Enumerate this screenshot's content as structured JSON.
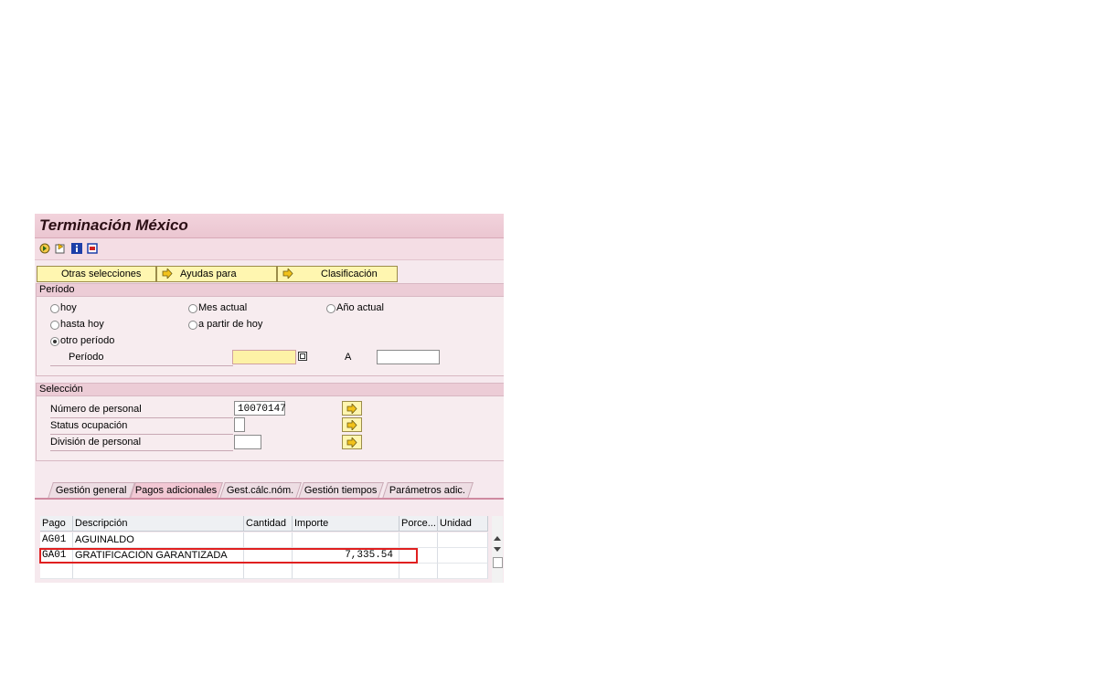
{
  "window": {
    "title": "Terminación México"
  },
  "app_toolbar": {
    "icons": [
      "execute-icon",
      "get-variant-icon",
      "info-icon",
      "selection-options-icon"
    ]
  },
  "buttons": {
    "otras_selecciones": "Otras selecciones",
    "ayudas_busqueda": "Ayudas para búsqueda",
    "clasificacion": "Clasificación"
  },
  "periodo": {
    "title": "Período",
    "options": {
      "hoy": "hoy",
      "mes_actual": "Mes actual",
      "ano_actual": "Año actual",
      "hasta_hoy": "hasta hoy",
      "a_partir": "a partir de hoy",
      "otro": "otro período"
    },
    "selected": "otro período",
    "field_label": "Período",
    "from_value": "",
    "to_label": "A",
    "to_value": ""
  },
  "seleccion": {
    "title": "Selección",
    "numero_label": "Número de personal",
    "numero_value": "10070147",
    "status_label": "Status ocupación",
    "status_value": "",
    "division_label": "División de personal",
    "division_value": ""
  },
  "tabs": [
    {
      "label": "Gestión general",
      "active": false
    },
    {
      "label": "Pagos adicionales",
      "active": true
    },
    {
      "label": "Gest.cálc.nóm.",
      "active": false
    },
    {
      "label": "Gestión tiempos",
      "active": false
    },
    {
      "label": "Parámetros adic.",
      "active": false
    }
  ],
  "table": {
    "headers": {
      "pago": "Pago",
      "descripcion": "Descripción",
      "cantidad": "Cantidad",
      "importe": "Importe",
      "porcentaje": "Porce...",
      "unidad": "Unidad"
    },
    "rows": [
      {
        "pago": "AG01",
        "descripcion": "AGUINALDO",
        "cantidad": "",
        "importe": "",
        "porcentaje": "",
        "unidad": ""
      },
      {
        "pago": "GA01",
        "descripcion": "GRATIFICACIÓN GARANTIZADA",
        "cantidad": "",
        "importe": "7,335.54",
        "porcentaje": "",
        "unidad": ""
      },
      {
        "pago": "",
        "descripcion": "",
        "cantidad": "",
        "importe": "",
        "porcentaje": "",
        "unidad": ""
      }
    ],
    "highlight_color": "#e02020"
  },
  "colors": {
    "title_bg": "#ebc6d1",
    "button_yellow": "#fff6b0",
    "required_field": "#fdf2a6"
  }
}
